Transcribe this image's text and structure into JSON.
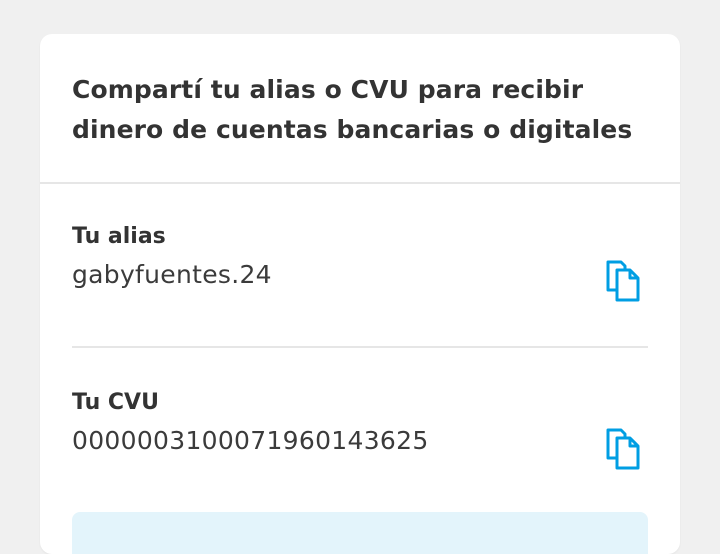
{
  "card": {
    "title": "Compartí tu alias o CVU para recibir dinero de cuentas bancarias o digitales"
  },
  "alias": {
    "label": "Tu alias",
    "value": "gabyfuentes.24",
    "copy_icon": "copy-icon"
  },
  "cvu": {
    "label": "Tu CVU",
    "value": "0000003100071960143625",
    "copy_icon": "copy-icon"
  },
  "colors": {
    "background": "#f0f0f0",
    "card": "#ffffff",
    "text": "#333333",
    "accent": "#009ee3",
    "divider": "#e6e6e6",
    "info_box": "#e3f4fb"
  }
}
